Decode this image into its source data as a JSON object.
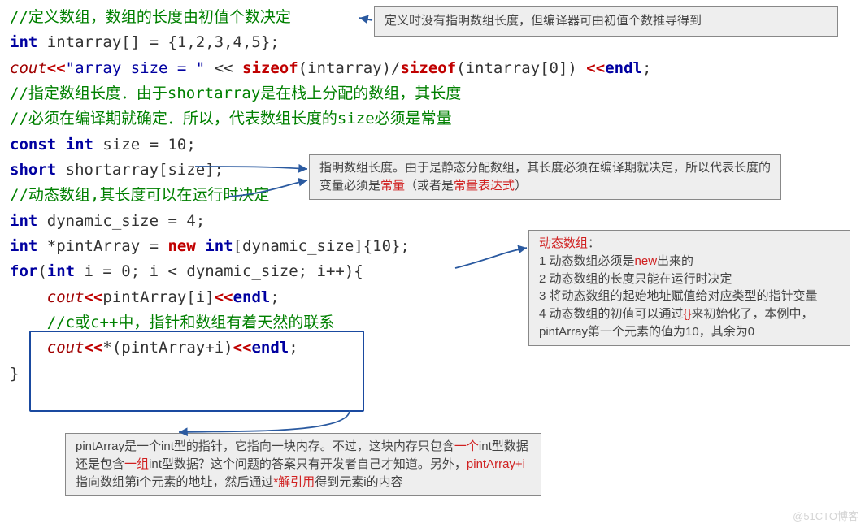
{
  "code": {
    "l1": "//定义数组，数组的长度由初值个数决定",
    "l2_kw": "int",
    "l2_rest": " intarray[] = {1,2,3,4,5};",
    "l3_cout": "cout",
    "l3_a": "<<",
    "l3_str": "\"array size = \"",
    "l3_b": " << ",
    "l3_sizeof": "sizeof",
    "l3_c": "(intarray)/",
    "l3_d": "(intarray[0]) ",
    "l3_e": "<<",
    "l3_endl": "endl",
    "l3_semi": ";",
    "l4": "//指定数组长度．由于shortarray是在栈上分配的数组，其长度",
    "l5": "//必须在编译期就确定．所以，代表数组长度的size必须是常量",
    "l6a_kw1": "const",
    "l6a_kw2": "int",
    "l6a_rest": " size = 10;",
    "l6b_kw": "short",
    "l6b_rest": " shortarray[size];",
    "l7": "//动态数组,其长度可以在运行时决定",
    "l8_kw": "int",
    "l8_rest": " dynamic_size = 4;",
    "l9_kw": "int",
    "l9_rest": " *pintArray = ",
    "l9_new": "new",
    "l9_kw2": "int",
    "l9_rest2": "[dynamic_size]{10};",
    "l10_kw": "for",
    "l10_a": "(",
    "l10_kw2": "int",
    "l10_b": " i = 0; i < dynamic_size; i++){",
    "l11_cout": "cout",
    "l11_a": "<<",
    "l11_b": "pintArray[i]",
    "l11_c": "<<",
    "l11_endl": "endl",
    "l11_d": ";",
    "l12": "//c或c++中，指针和数组有着天然的联系",
    "l13_cout": "cout",
    "l13_a": "<<",
    "l13_b": "*(pintArray+i)",
    "l13_c": "<<",
    "l13_endl": "endl",
    "l13_d": ";",
    "l14": "}"
  },
  "ann1": "定义时没有指明数组长度，但编译器可由初值个数推导得到",
  "ann2_a": "指明数组长度。由于是静态分配数组，其长度必须在编译期就决定，所以代表长度的变量必须是",
  "ann2_b": "常量",
  "ann2_c": "（或者是",
  "ann2_d": "常量表达式",
  "ann2_e": "）",
  "ann3_title": "动态数组",
  "ann3_1a": "1 动态数组必须是",
  "ann3_1b": "new",
  "ann3_1c": "出来的",
  "ann3_2": "2 动态数组的长度只能在运行时决定",
  "ann3_3": "3 将动态数组的起始地址赋值给对应类型的指针变量",
  "ann3_4a": "4 动态数组的初值可以通过",
  "ann3_4b": "{}",
  "ann3_4c": "来初始化了，本例中，pintArray第一个元素的值为10，其余为0",
  "ann4_a": "pintArray是一个int型的指针，它指向一块内存。不过，这块内存只包含",
  "ann4_b": "一个",
  "ann4_c": "int型数据还是包含",
  "ann4_d": "一组",
  "ann4_e": "int型数据？这个问题的答案只有开发者自己才知道。另外，",
  "ann4_f": "pintArray+i",
  "ann4_g": "指向数组第i个元素的地址，然后通过",
  "ann4_h": "*解引用",
  "ann4_i": "得到元素i的内容",
  "watermark": "@51CTO博客"
}
